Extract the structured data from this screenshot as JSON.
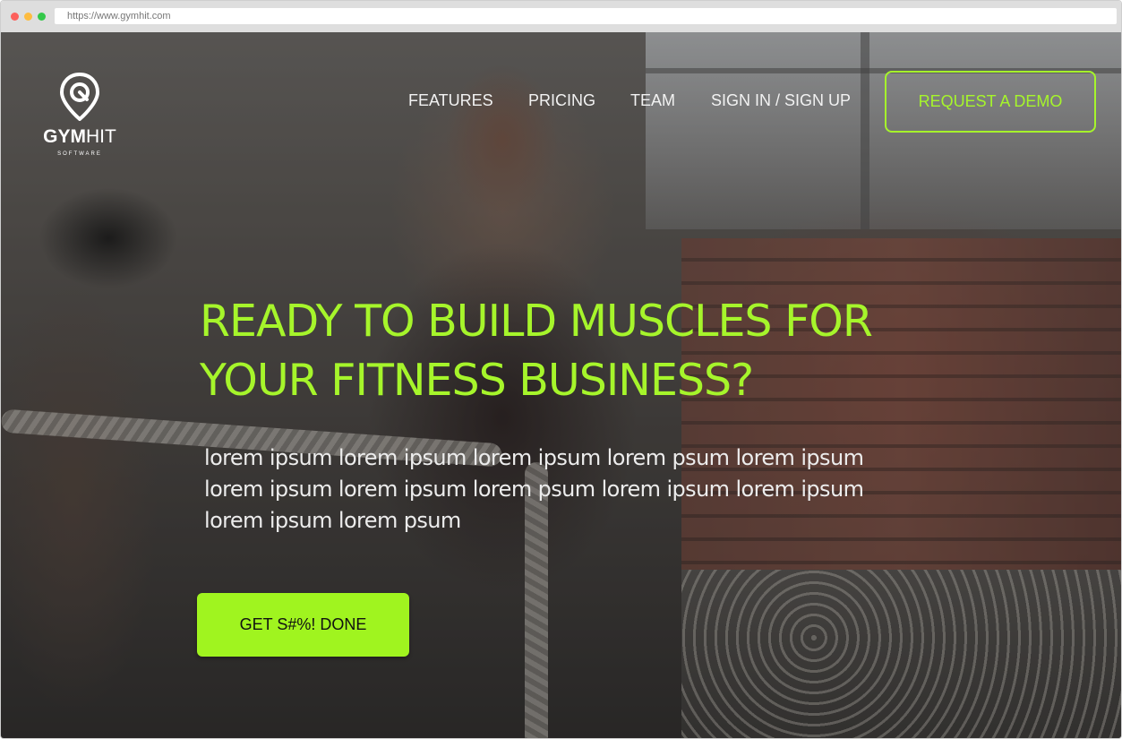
{
  "browser": {
    "url": "https://www.gymhit.com"
  },
  "brand": {
    "name_bold": "GYM",
    "name_light": "HIT",
    "tagline": "SOFTWARE",
    "logo_icon": "map-pin-icon"
  },
  "nav": {
    "items": [
      {
        "label": "FEATURES"
      },
      {
        "label": "PRICING"
      },
      {
        "label": "TEAM"
      },
      {
        "label": "SIGN IN / SIGN UP"
      }
    ],
    "demo_label": "REQUEST A DEMO"
  },
  "hero": {
    "headline_lines": [
      "READY TO BUILD MUSCLES FOR",
      "YOUR FITNESS BUSINESS?"
    ],
    "body_lines": [
      "lorem ipsum lorem ipsum lorem ipsum lorem psum lorem ipsum",
      "lorem ipsum lorem ipsum lorem psum lorem ipsum lorem ipsum",
      "lorem ipsum lorem psum"
    ],
    "cta_label": "GET S#%! DONE"
  },
  "colors": {
    "accent": "#a6f52b",
    "cta_fill": "#a0f41f",
    "nav_text": "#f2f2f2"
  }
}
